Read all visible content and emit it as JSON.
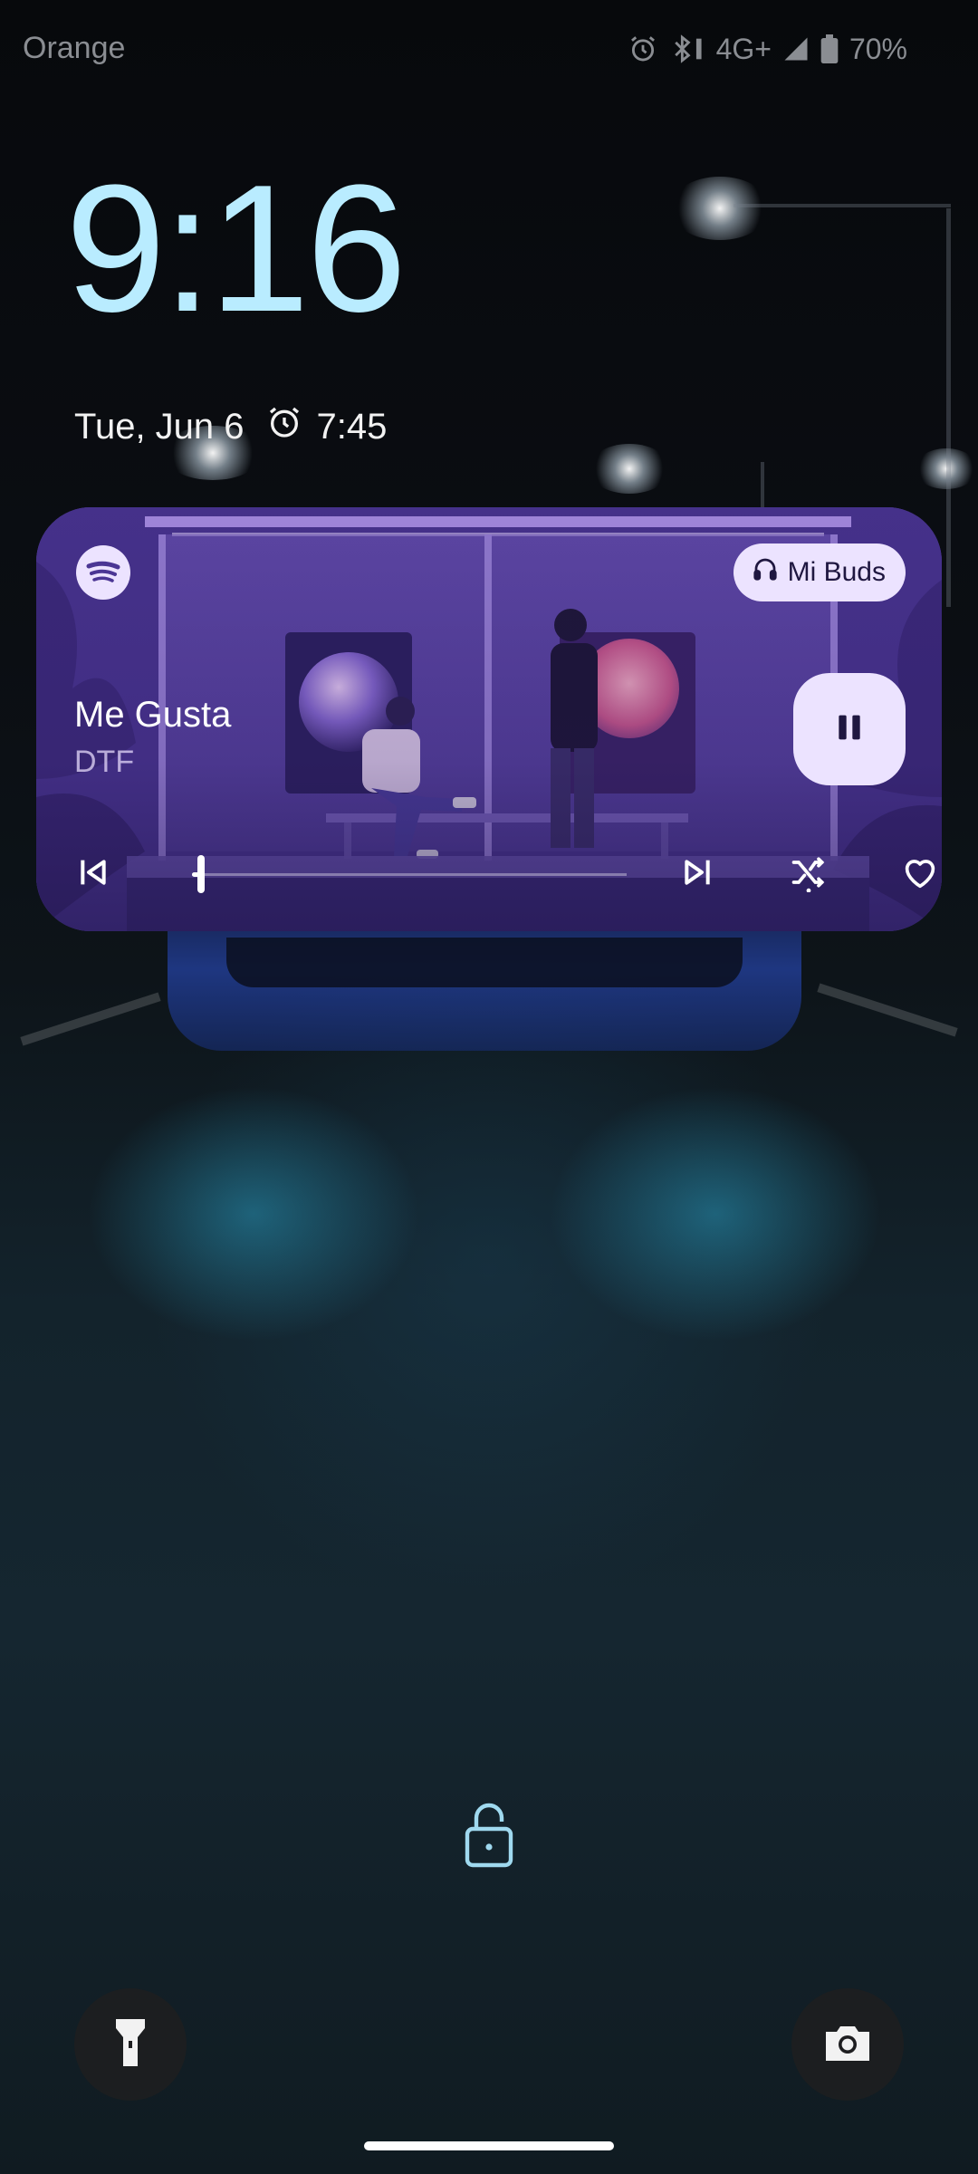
{
  "status_bar": {
    "carrier": "Orange",
    "network": "4G+",
    "battery": "70%",
    "icons": [
      "alarm-icon",
      "bluetooth-icon",
      "signal-icon",
      "battery-icon"
    ]
  },
  "lockscreen": {
    "time": "9:16",
    "date": "Tue, Jun 6",
    "alarm_time": "7:45"
  },
  "media": {
    "app_icon": "spotify-icon",
    "device_label": "Mi Buds",
    "title": "Me Gusta",
    "artist": "DTF",
    "state": "playing",
    "progress": 0.02,
    "controls": [
      "previous-icon",
      "pause-icon",
      "next-icon",
      "shuffle-icon",
      "heart-icon"
    ]
  },
  "shortcuts": {
    "left": "flashlight-icon",
    "right": "camera-icon"
  },
  "colors": {
    "clock": "#b9ecff",
    "media_accent": "#ece3ff",
    "card_bg": "#4b3694"
  }
}
